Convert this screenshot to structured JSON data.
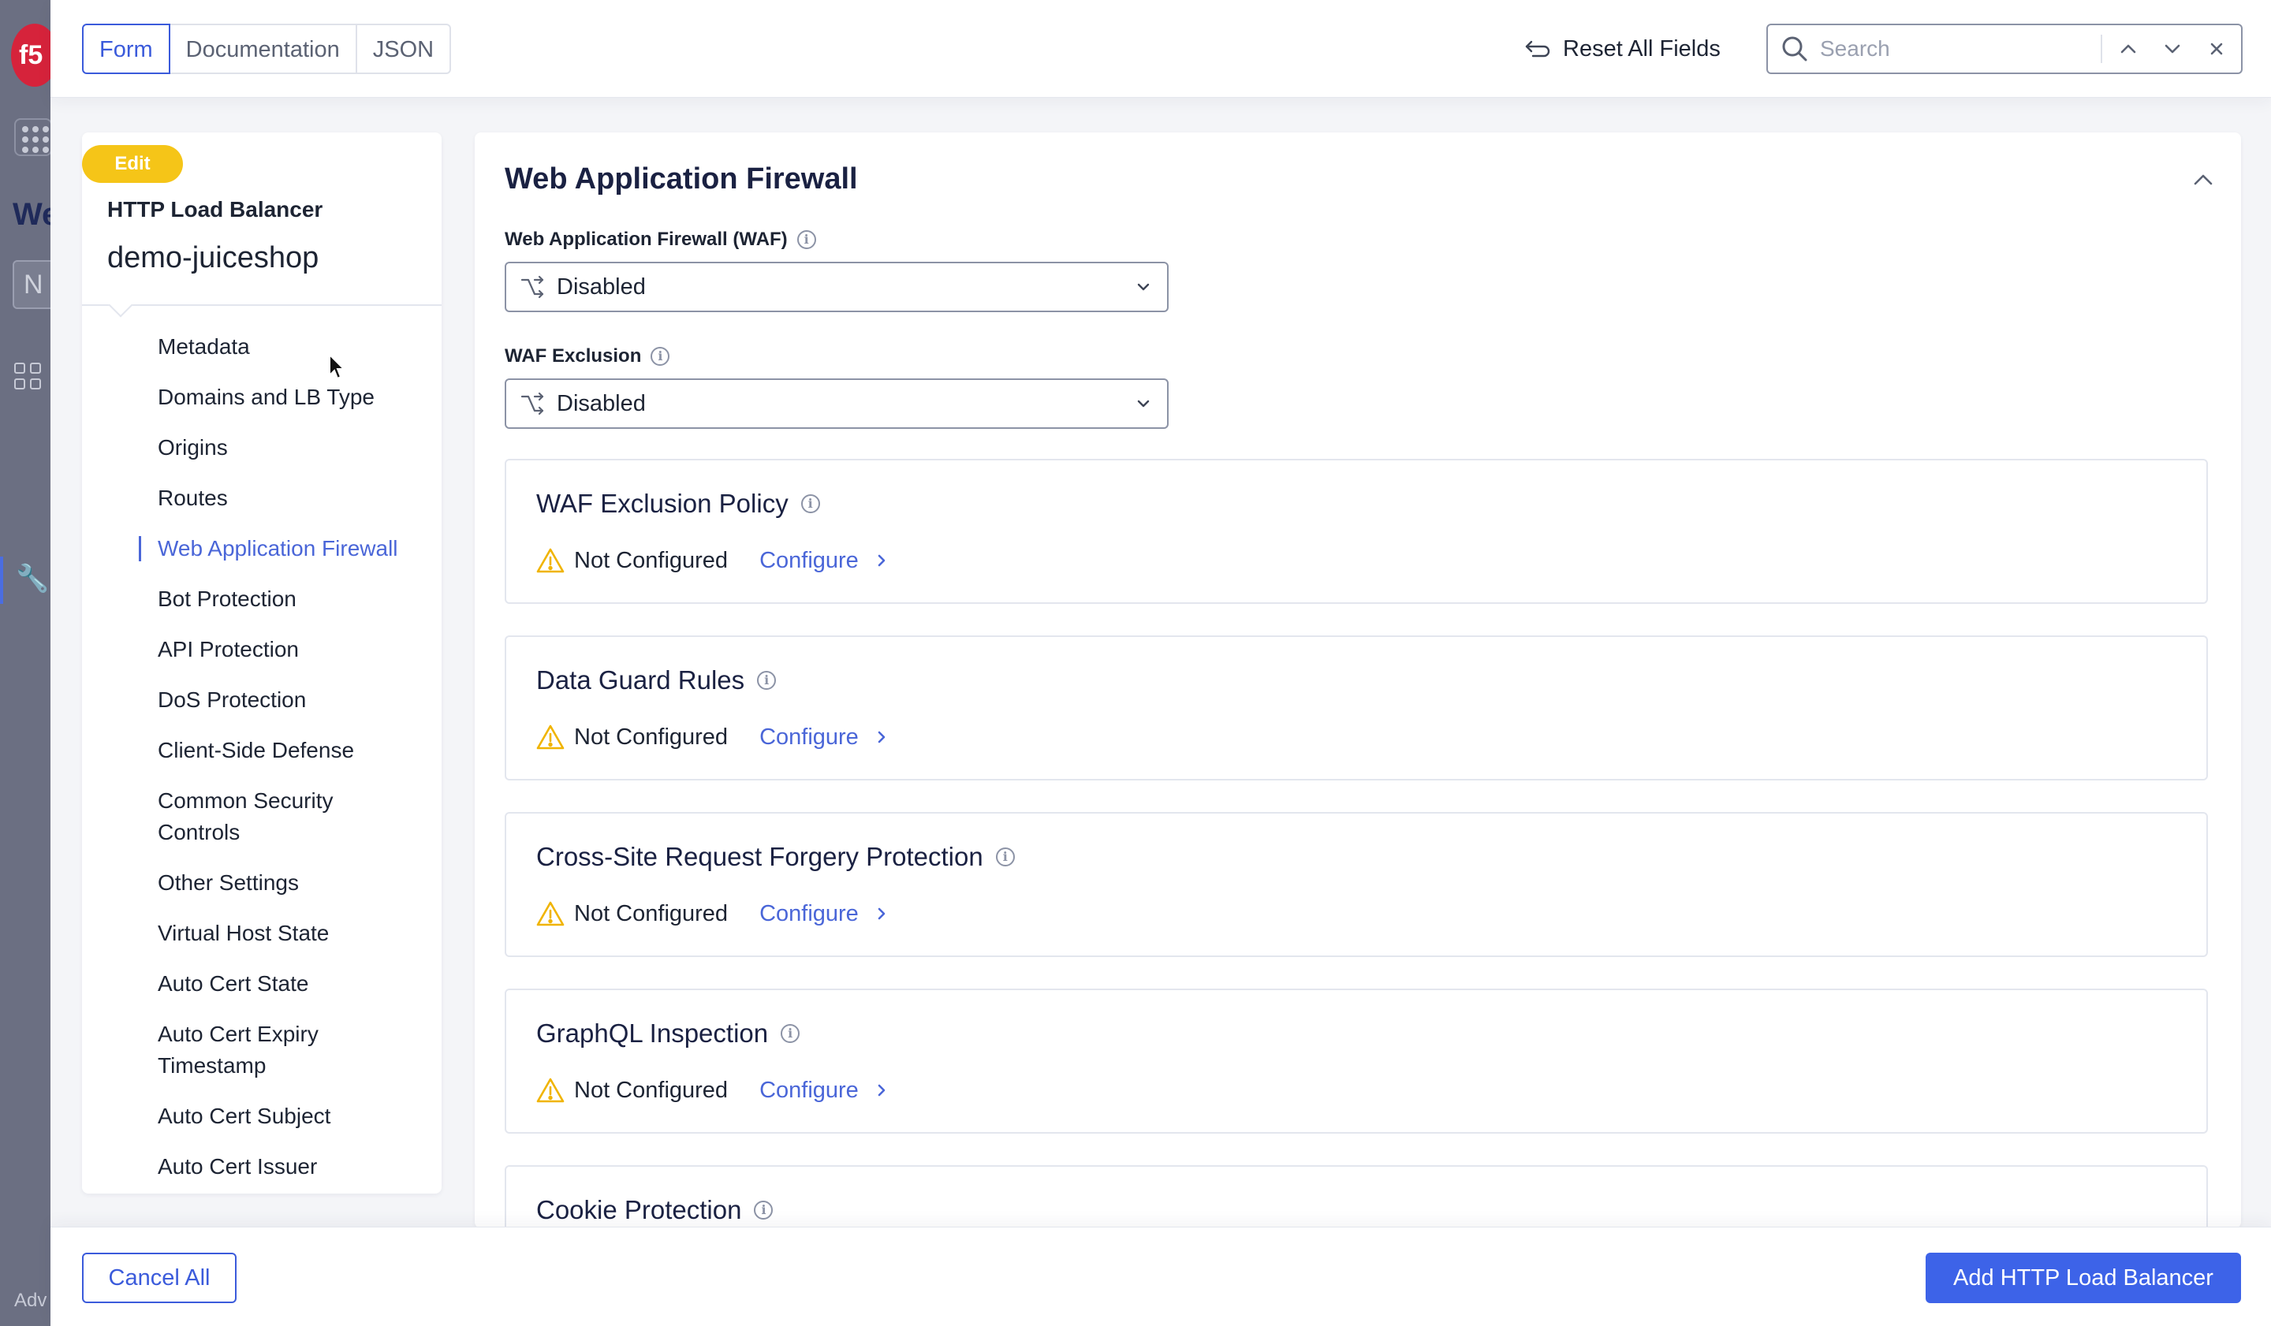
{
  "view_tabs": [
    {
      "label": "Form",
      "active": true
    },
    {
      "label": "Documentation",
      "active": false
    },
    {
      "label": "JSON",
      "active": false
    }
  ],
  "toolbar": {
    "reset_label": "Reset All Fields",
    "search_placeholder": "Search"
  },
  "sidebar": {
    "badge": "Edit",
    "object_type": "HTTP Load Balancer",
    "object_name": "demo-juiceshop",
    "items": [
      {
        "label": "Metadata"
      },
      {
        "label": "Domains and LB Type"
      },
      {
        "label": "Origins"
      },
      {
        "label": "Routes"
      },
      {
        "label": "Web Application Firewall",
        "active": true
      },
      {
        "label": "Bot Protection"
      },
      {
        "label": "API Protection"
      },
      {
        "label": "DoS Protection"
      },
      {
        "label": "Client-Side Defense"
      },
      {
        "label": "Common Security Controls"
      },
      {
        "label": "Other Settings"
      },
      {
        "label": "Virtual Host State"
      },
      {
        "label": "Auto Cert State"
      },
      {
        "label": "Auto Cert Expiry Timestamp"
      },
      {
        "label": "Auto Cert Subject"
      },
      {
        "label": "Auto Cert Issuer"
      }
    ]
  },
  "main": {
    "section_title": "Web Application Firewall",
    "waf_field": {
      "label": "Web Application Firewall (WAF)",
      "value": "Disabled"
    },
    "waf_exclusion_field": {
      "label": "WAF Exclusion",
      "value": "Disabled"
    },
    "cards": [
      {
        "title": "WAF Exclusion Policy",
        "status": "Not Configured",
        "action": "Configure"
      },
      {
        "title": "Data Guard Rules",
        "status": "Not Configured",
        "action": "Configure"
      },
      {
        "title": "Cross-Site Request Forgery Protection",
        "status": "Not Configured",
        "action": "Configure"
      },
      {
        "title": "GraphQL Inspection",
        "status": "Not Configured",
        "action": "Configure"
      },
      {
        "title": "Cookie Protection",
        "status": "",
        "action": ""
      }
    ]
  },
  "footer": {
    "cancel_label": "Cancel All",
    "submit_label": "Add HTTP Load Balancer"
  },
  "background_app": {
    "logo_text": "f5",
    "partial_heading": "We",
    "partial_field": "N",
    "partial_footer": "Adv"
  },
  "colors": {
    "accent": "#3b5bdb",
    "badge": "#f5c518",
    "warning": "#f0b400"
  }
}
